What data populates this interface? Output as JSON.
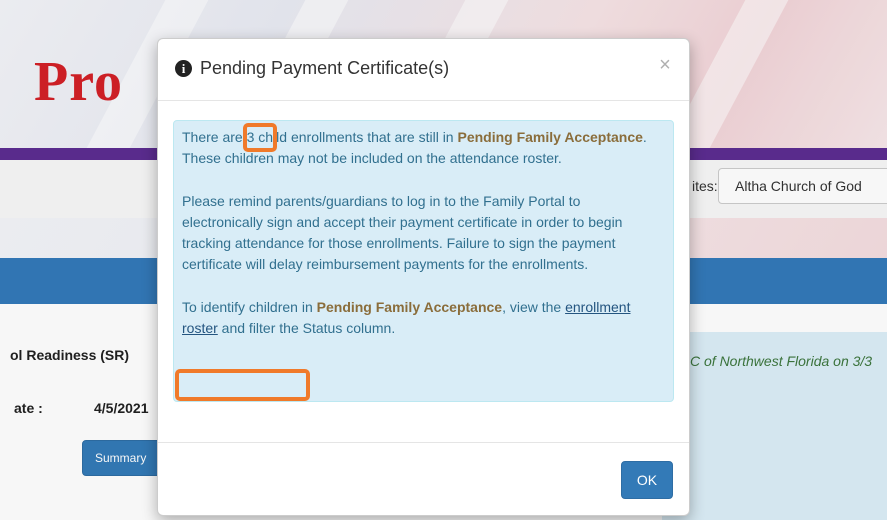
{
  "background": {
    "logo_text": "Pro",
    "sites_label": "ites:",
    "sites_selected": "Altha Church of God",
    "program_label": "ol Readiness (SR)",
    "date_label": "ate :",
    "date_value": "4/5/2021",
    "summary_button": "Summary",
    "right_note": "C of Northwest Florida on 3/3"
  },
  "modal": {
    "title": "Pending Payment Certificate(s)",
    "close_glyph": "×",
    "para1": {
      "t1": "There are ",
      "count": "3",
      "t2": " child enrollments that are still in ",
      "highlight": "Pending Family Acceptance",
      "t3": ". These children may not be included on the attendance roster."
    },
    "para2": "Please remind parents/guardians to log in to the Family Portal to electronically sign and accept their payment certificate in order to begin tracking attendance for those enrollments. Failure to sign the payment certificate will delay reimbursement payments for the enrollments.",
    "para3": {
      "t1": "To identify children in ",
      "highlight": "Pending Family Acceptance",
      "t2": ", view the ",
      "link": "enrollment roster",
      "t3": " and filter the Status column."
    },
    "ok_button": "OK"
  },
  "colors": {
    "accent": "#337ab7",
    "alert_bg": "#d9edf7",
    "alert_text": "#31708f",
    "highlight_text": "#8a6d3b",
    "annotation_orange": "#f07a2a",
    "brand_red": "#d32027",
    "brand_purple": "#5c2d91"
  },
  "icons": {
    "title_icon": "info-circle-icon",
    "close_icon": "close-icon"
  }
}
